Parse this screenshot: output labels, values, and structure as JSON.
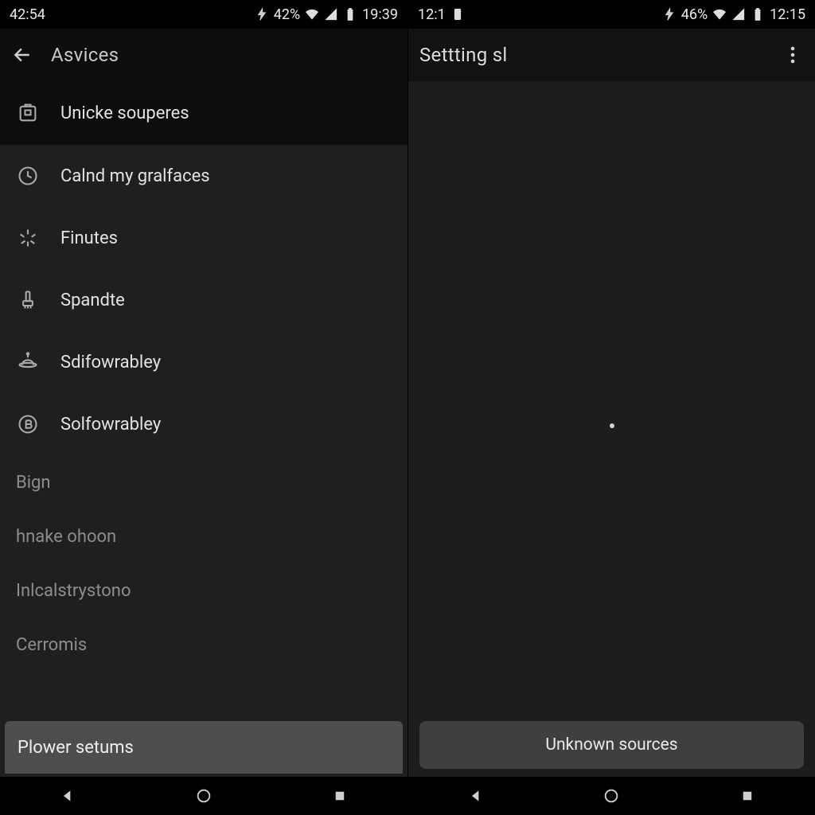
{
  "left": {
    "status": {
      "left_time": "42:54",
      "battery_pct": "42%",
      "right_time": "19:39"
    },
    "appbar": {
      "title": "Asvices"
    },
    "items": [
      {
        "label": "Unicke souperes",
        "icon": "package-icon"
      },
      {
        "label": "Calnd my gralfaces",
        "icon": "clock-icon"
      },
      {
        "label": "Finutes",
        "icon": "spark-icon"
      },
      {
        "label": "Spandte",
        "icon": "brush-icon"
      },
      {
        "label": "Sdifowrabley",
        "icon": "hat-icon"
      },
      {
        "label": "Solfowrabley",
        "icon": "circle-b-icon"
      }
    ],
    "plain_items": [
      {
        "label": "Bign"
      },
      {
        "label": "hnake ohoon"
      },
      {
        "label": "Inlcalstrystono"
      },
      {
        "label": "Cerromis"
      }
    ],
    "bottom_pill": "Plower setums"
  },
  "right": {
    "status": {
      "left_time": "12:1",
      "battery_pct": "46%",
      "right_time": "12:15"
    },
    "appbar": {
      "title": "Settting sl"
    },
    "bottom_pill": "Unknown sources"
  }
}
